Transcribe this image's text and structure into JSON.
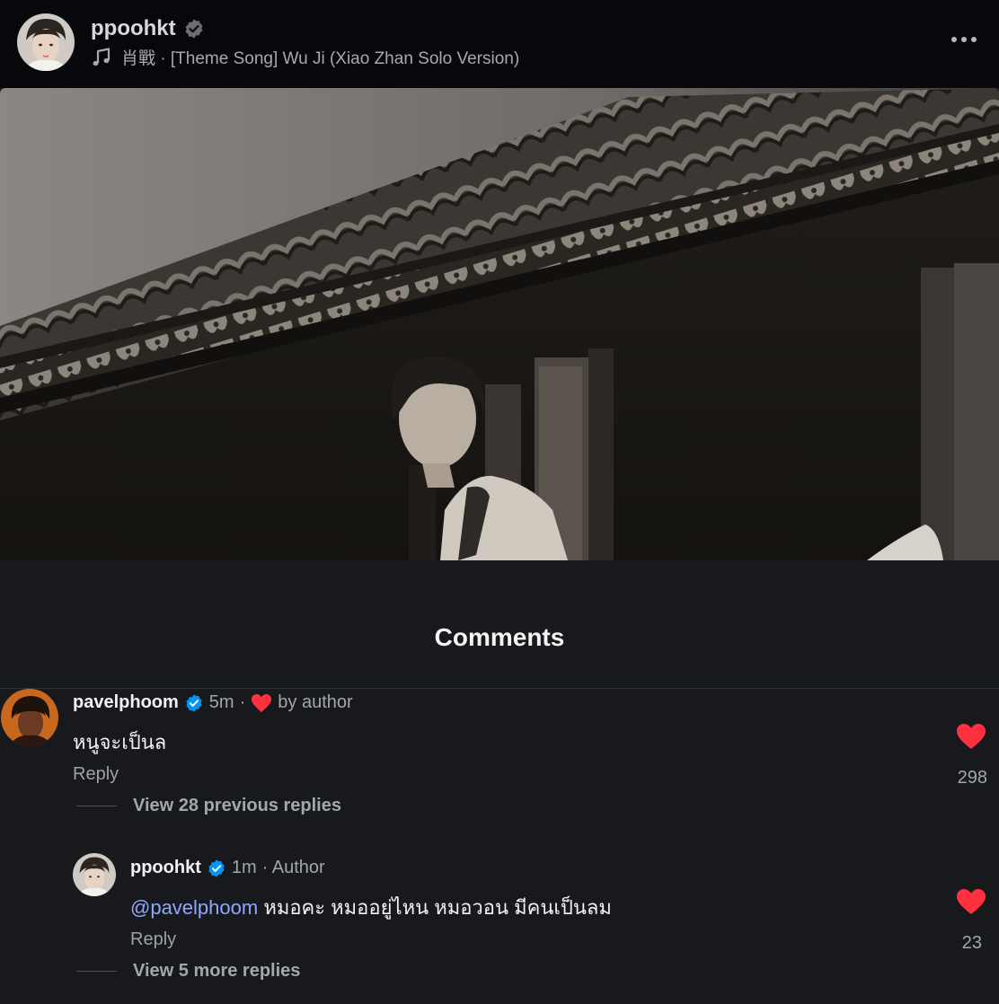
{
  "header": {
    "username": "ppoohkt",
    "song": "肖戰 · [Theme Song] Wu Ji (Xiao Zhan Solo Version)"
  },
  "comments_section": {
    "title": "Comments"
  },
  "comments": [
    {
      "username": "pavelphoom",
      "time": "5m",
      "separator": "·",
      "liked_by": "by author",
      "text": "หนูจะเป็นล",
      "reply_label": "Reply",
      "likes": "298",
      "view_replies": "View 28 previous replies"
    },
    {
      "username": "ppoohkt",
      "time": "1m",
      "author_label": "· Author",
      "mention": "@pavelphoom",
      "text": " หมอคะ หมออยู่ไหน หมอวอน มีคนเป็นลม",
      "reply_label": "Reply",
      "likes": "23",
      "view_replies": "View 5 more replies"
    }
  ],
  "colors": {
    "background": "#17191d",
    "header": "#06080b",
    "like_red": "#ff3040",
    "verified_blue": "#0095f6",
    "mention": "#8fa8ff"
  },
  "icons": [
    "verified-badge-icon",
    "music-note-icon",
    "more-options-icon",
    "heart-icon"
  ]
}
